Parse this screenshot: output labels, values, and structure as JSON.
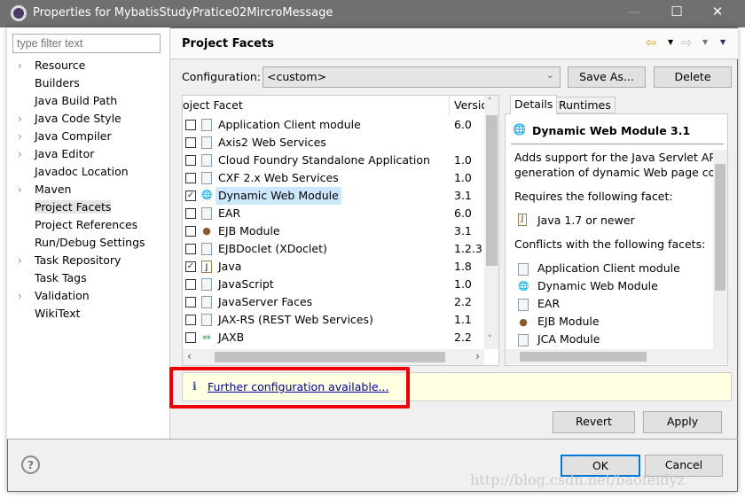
{
  "window": {
    "title": "Properties for MybatisStudyPratice02MircroMessage",
    "minimize": "—",
    "maximize": "☐",
    "close": "✕"
  },
  "sidebar": {
    "filter_placeholder": "type filter text",
    "items": [
      {
        "label": "Resource",
        "expandable": true
      },
      {
        "label": "Builders",
        "expandable": false
      },
      {
        "label": "Java Build Path",
        "expandable": false
      },
      {
        "label": "Java Code Style",
        "expandable": true
      },
      {
        "label": "Java Compiler",
        "expandable": true
      },
      {
        "label": "Java Editor",
        "expandable": true
      },
      {
        "label": "Javadoc Location",
        "expandable": false
      },
      {
        "label": "Maven",
        "expandable": true
      },
      {
        "label": "Project Facets",
        "expandable": false,
        "selected": true
      },
      {
        "label": "Project References",
        "expandable": false
      },
      {
        "label": "Run/Debug Settings",
        "expandable": false
      },
      {
        "label": "Task Repository",
        "expandable": true
      },
      {
        "label": "Task Tags",
        "expandable": false
      },
      {
        "label": "Validation",
        "expandable": true
      },
      {
        "label": "WikiText",
        "expandable": false
      }
    ]
  },
  "header": {
    "title": "Project Facets"
  },
  "config": {
    "label": "Configuration:",
    "value": "<custom>",
    "save_as": "Save As...",
    "delete": "Delete"
  },
  "facets": {
    "col_facet": "oject Facet",
    "col_version": "Versio",
    "rows": [
      {
        "name": "Application Client module",
        "version": "6.0",
        "checked": false,
        "icon": "doc"
      },
      {
        "name": "Axis2 Web Services",
        "version": "",
        "checked": false,
        "icon": "doc"
      },
      {
        "name": "Cloud Foundry Standalone Application",
        "version": "1.0",
        "checked": false,
        "icon": "doc"
      },
      {
        "name": "CXF 2.x Web Services",
        "version": "1.0",
        "checked": false,
        "icon": "doc"
      },
      {
        "name": "Dynamic Web Module",
        "version": "3.1",
        "checked": true,
        "icon": "web",
        "selected": true
      },
      {
        "name": "EAR",
        "version": "6.0",
        "checked": false,
        "icon": "doc"
      },
      {
        "name": "EJB Module",
        "version": "3.1",
        "checked": false,
        "icon": "ejb"
      },
      {
        "name": "EJBDoclet (XDoclet)",
        "version": "1.2.3",
        "checked": false,
        "icon": "doc"
      },
      {
        "name": "Java",
        "version": "1.8",
        "checked": true,
        "icon": "java"
      },
      {
        "name": "JavaScript",
        "version": "1.0",
        "checked": false,
        "icon": "doc"
      },
      {
        "name": "JavaServer Faces",
        "version": "2.2",
        "checked": false,
        "icon": "doc"
      },
      {
        "name": "JAX-RS (REST Web Services)",
        "version": "1.1",
        "checked": false,
        "icon": "doc"
      },
      {
        "name": "JAXB",
        "version": "2.2",
        "checked": false,
        "icon": "jaxb"
      }
    ]
  },
  "details": {
    "tab_details": "Details",
    "tab_runtimes": "Runtimes",
    "title": "Dynamic Web Module 3.1",
    "desc1": "Adds support for the Java Servlet API,",
    "desc2": "generation of dynamic Web page cont",
    "requires_label": "Requires the following facet:",
    "requires": [
      {
        "name": "Java 1.7 or newer",
        "icon": "java"
      }
    ],
    "conflicts_label": "Conflicts with the following facets:",
    "conflicts": [
      {
        "name": "Application Client module",
        "icon": "doc"
      },
      {
        "name": "Dynamic Web Module",
        "icon": "web"
      },
      {
        "name": "EAR",
        "icon": "doc"
      },
      {
        "name": "EJB Module",
        "icon": "ejb"
      },
      {
        "name": "JCA Module",
        "icon": "doc"
      }
    ]
  },
  "info": {
    "icon": "i",
    "link": "Further configuration available..."
  },
  "buttons": {
    "revert": "Revert",
    "apply": "Apply",
    "ok": "OK",
    "cancel": "Cancel"
  },
  "watermark": "http://blog.csdn.net/baofeidyz"
}
